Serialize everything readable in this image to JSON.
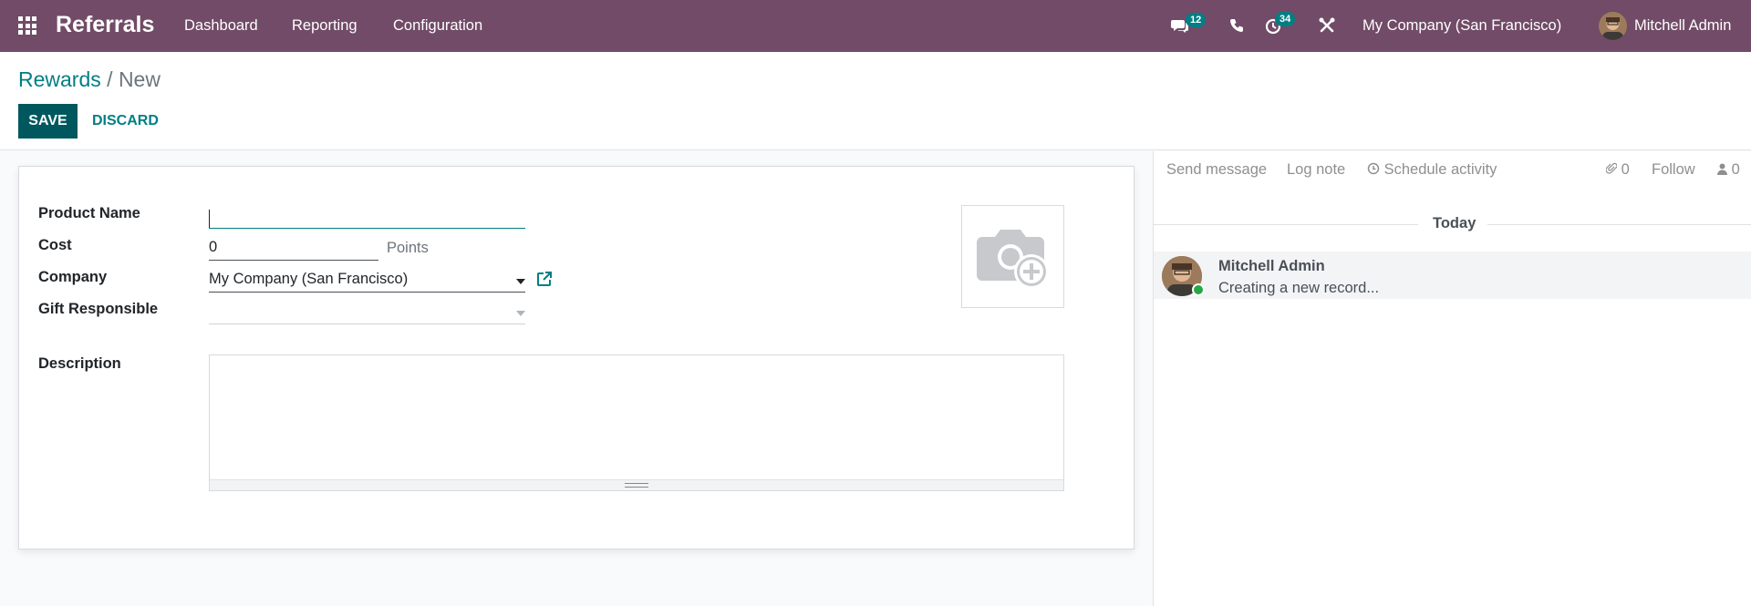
{
  "navbar": {
    "app_title": "Referrals",
    "menu": [
      "Dashboard",
      "Reporting",
      "Configuration"
    ],
    "messages_badge": "12",
    "activities_badge": "34",
    "company": "My Company (San Francisco)",
    "user": "Mitchell Admin",
    "bg_color": "#714B67"
  },
  "breadcrumb": {
    "parent": "Rewards",
    "separator": "/",
    "current": "New"
  },
  "actions": {
    "save": "Save",
    "discard": "Discard"
  },
  "form": {
    "product_name_label": "Product Name",
    "product_name_value": "",
    "cost_label": "Cost",
    "cost_value": "0",
    "cost_unit": "Points",
    "company_label": "Company",
    "company_value": "My Company (San Francisco)",
    "gift_responsible_label": "Gift Responsible",
    "gift_responsible_value": "",
    "description_label": "Description",
    "description_value": ""
  },
  "chatter": {
    "send_message": "Send message",
    "log_note": "Log note",
    "schedule_activity": "Schedule activity",
    "attachments_count": "0",
    "follow": "Follow",
    "followers_count": "0",
    "date_separator": "Today",
    "messages": [
      {
        "author": "Mitchell Admin",
        "body": "Creating a new record..."
      }
    ]
  }
}
